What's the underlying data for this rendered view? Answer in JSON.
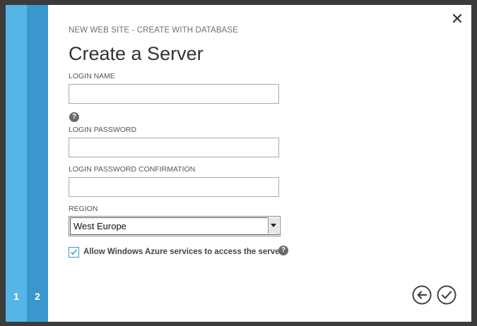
{
  "wizard": {
    "steps": [
      {
        "label": "1"
      },
      {
        "label": "2"
      }
    ],
    "breadcrumb": "NEW WEB SITE - CREATE WITH DATABASE",
    "title": "Create a Server"
  },
  "form": {
    "login_name": {
      "label": "LOGIN NAME",
      "value": "",
      "placeholder": ""
    },
    "login_password": {
      "label": "LOGIN PASSWORD",
      "value": ""
    },
    "login_password_confirmation": {
      "label": "LOGIN PASSWORD CONFIRMATION",
      "value": ""
    },
    "region": {
      "label": "REGION",
      "selected": "West Europe"
    },
    "allow_azure": {
      "label": "Allow Windows Azure services to access the server",
      "checked": true
    }
  },
  "icons": {
    "close": "close-icon",
    "help": "help-icon",
    "back": "arrow-left-icon",
    "complete": "checkmark-icon"
  },
  "colors": {
    "step1": "#56b4e6",
    "step2": "#3a97cd",
    "accent": "#3a97cd"
  }
}
